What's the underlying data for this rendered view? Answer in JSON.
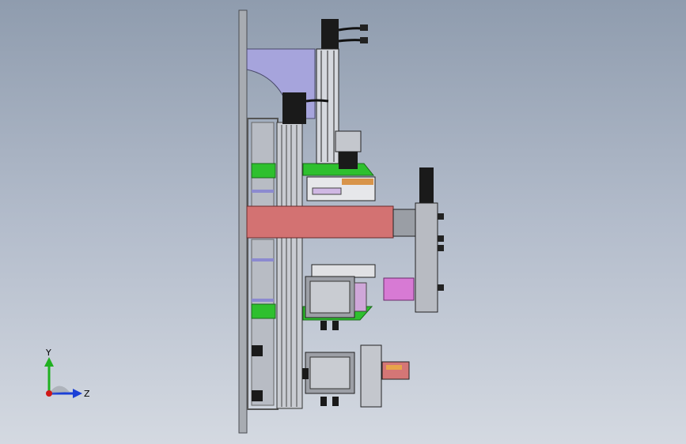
{
  "viewport": {
    "background_top": "#8f9cae",
    "background_bottom": "#d4d9e1"
  },
  "triad": {
    "y_label": "Y",
    "z_label": "Z",
    "y_color": "#20b020",
    "z_color": "#1a3fd6",
    "x_color": "#d01818"
  },
  "colors": {
    "plate": "#a8acb2",
    "frame": "#b8bcc4",
    "lavender": "#a6a4dc",
    "green": "#2ec02e",
    "salmon": "#d37272",
    "magenta": "#d77ad4",
    "motor": "#1a1a1a",
    "gray_motor": "#9c9fa6"
  }
}
